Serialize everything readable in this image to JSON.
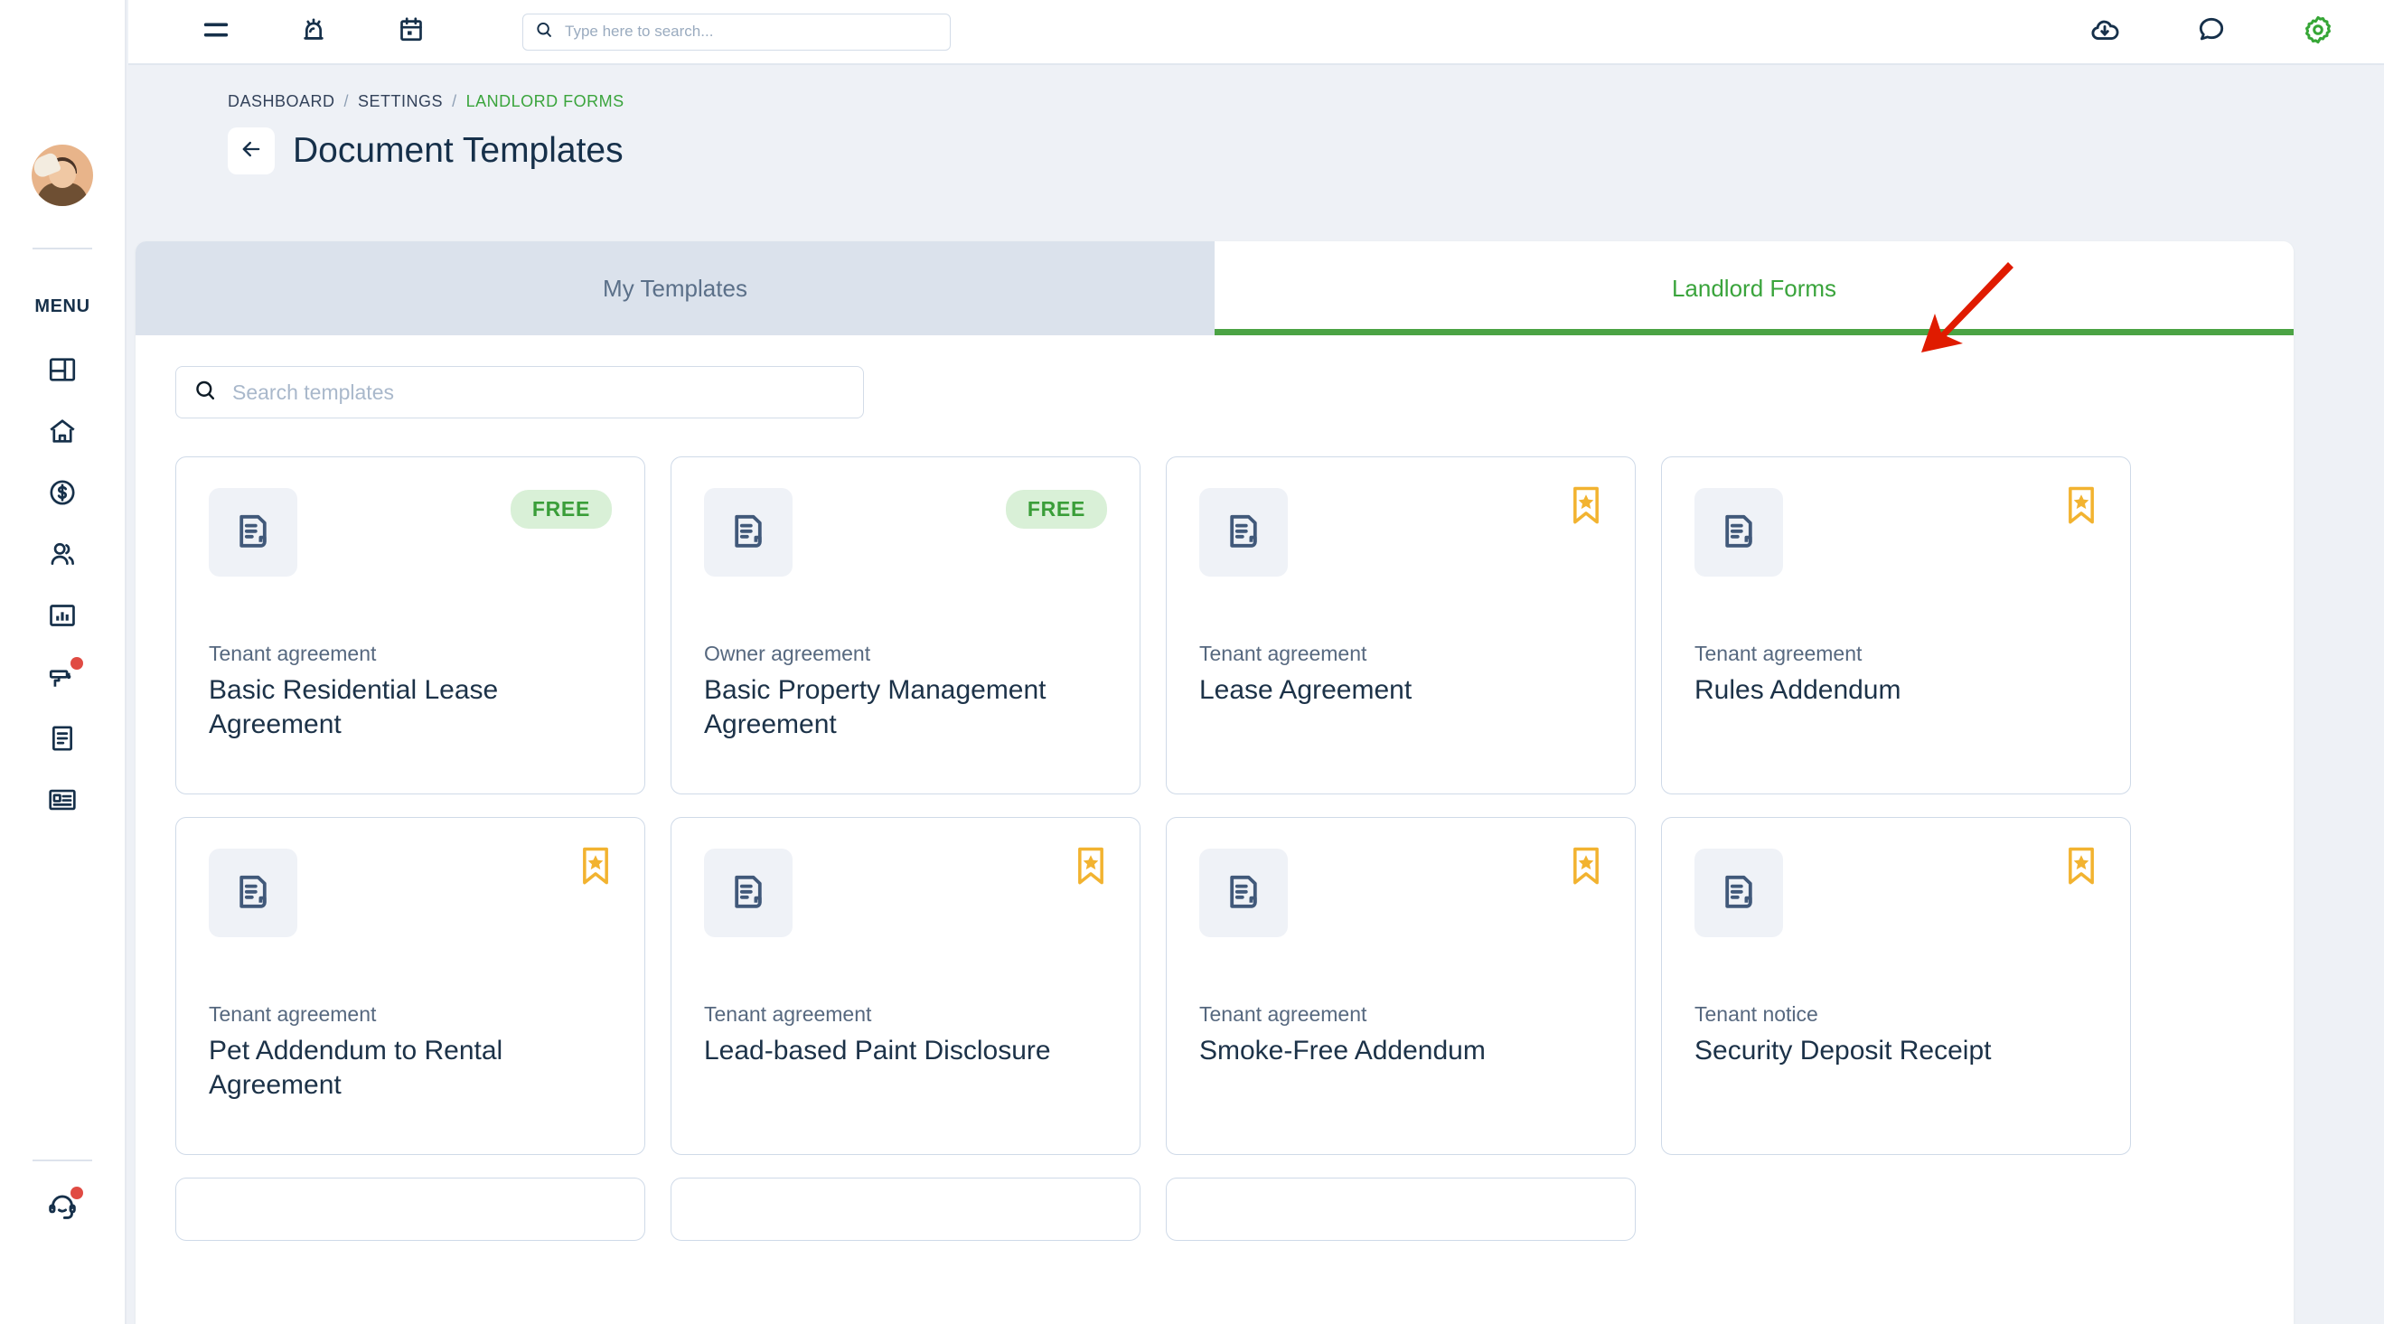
{
  "topbar": {
    "menu_icon": "hamburger-menu-icon",
    "alarm_icon": "alarm-bell-icon",
    "calendar_icon": "calendar-icon",
    "search": {
      "value": "",
      "placeholder": "Type here to search..."
    },
    "download_icon": "cloud-download-icon",
    "chat_icon": "chat-bubble-icon",
    "settings_icon": "gear-icon",
    "settings_color": "#36a636"
  },
  "sidebar": {
    "menu_label": "MENU",
    "avatar_name": "user-avatar",
    "items": [
      {
        "icon": "dashboard-grid-icon",
        "name": "sidebar-item-dashboard",
        "badge": false
      },
      {
        "icon": "home-icon",
        "name": "sidebar-item-properties",
        "badge": false
      },
      {
        "icon": "dollar-circle-icon",
        "name": "sidebar-item-accounting",
        "badge": false
      },
      {
        "icon": "people-icon",
        "name": "sidebar-item-contacts",
        "badge": false
      },
      {
        "icon": "bar-chart-icon",
        "name": "sidebar-item-reports",
        "badge": false
      },
      {
        "icon": "paint-roller-icon",
        "name": "sidebar-item-maintenance",
        "badge": true
      },
      {
        "icon": "document-icon",
        "name": "sidebar-item-documents",
        "badge": false
      },
      {
        "icon": "id-card-icon",
        "name": "sidebar-item-listings",
        "badge": false
      }
    ],
    "support": {
      "icon": "headset-support-icon",
      "name": "sidebar-item-support",
      "badge": true
    },
    "badge_color": "#e04b43"
  },
  "breadcrumb": {
    "items": [
      "DASHBOARD",
      "SETTINGS",
      "LANDLORD FORMS"
    ],
    "separator": "/",
    "active_index": 2,
    "active_color": "#3aa43c"
  },
  "page": {
    "title": "Document Templates",
    "back_icon": "arrow-left-icon"
  },
  "tabs": [
    {
      "label": "My Templates",
      "active": false
    },
    {
      "label": "Landlord Forms",
      "active": true
    }
  ],
  "tab_accent_color": "#4ba344",
  "template_search": {
    "value": "",
    "placeholder": "Search templates"
  },
  "cards": [
    {
      "kicker": "Tenant agreement",
      "title": "Basic Residential Lease Agreement",
      "badge": "FREE",
      "badge_type": "free",
      "icon": "document-template-icon"
    },
    {
      "kicker": "Owner agreement",
      "title": "Basic Property Management Agreement",
      "badge": "FREE",
      "badge_type": "free",
      "icon": "document-template-icon"
    },
    {
      "kicker": "Tenant agreement",
      "title": "Lease Agreement",
      "badge": "",
      "badge_type": "bookmark",
      "icon": "document-template-icon"
    },
    {
      "kicker": "Tenant agreement",
      "title": "Rules Addendum",
      "badge": "",
      "badge_type": "bookmark",
      "icon": "document-template-icon"
    },
    {
      "kicker": "Tenant agreement",
      "title": "Pet Addendum to Rental Agreement",
      "badge": "",
      "badge_type": "bookmark",
      "icon": "document-template-icon"
    },
    {
      "kicker": "Tenant agreement",
      "title": "Lead-based Paint Disclosure",
      "badge": "",
      "badge_type": "bookmark",
      "icon": "document-template-icon"
    },
    {
      "kicker": "Tenant agreement",
      "title": "Smoke-Free Addendum",
      "badge": "",
      "badge_type": "bookmark",
      "icon": "document-template-icon"
    },
    {
      "kicker": "Tenant notice",
      "title": "Security Deposit Receipt",
      "badge": "",
      "badge_type": "bookmark",
      "icon": "document-template-icon"
    }
  ],
  "partial_row_card_count": 3,
  "badge_colors": {
    "free_bg": "#d9f0d7",
    "free_text": "#3a9e39",
    "bookmark": "#f2b330"
  },
  "annotation": {
    "type": "red-arrow",
    "color": "#e01b00",
    "points_at": "Landlord Forms"
  }
}
